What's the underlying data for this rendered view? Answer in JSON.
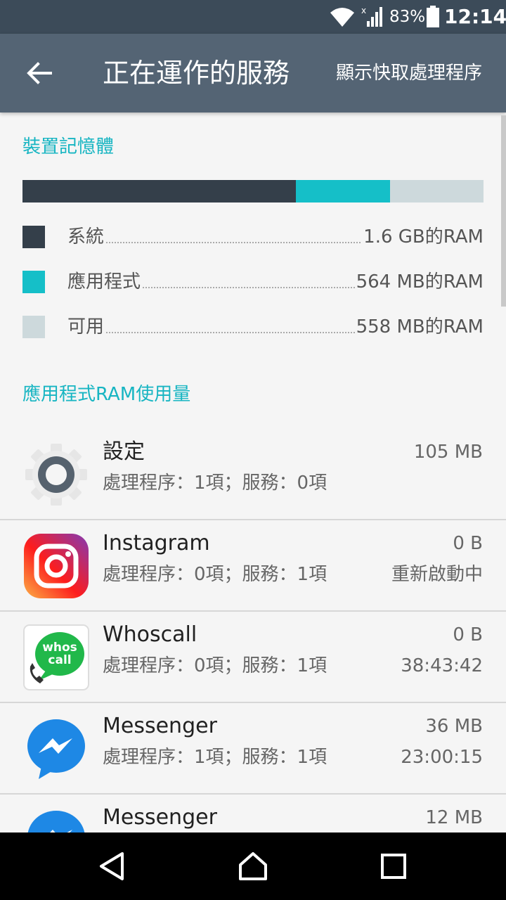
{
  "status_bar": {
    "battery_percent": "83%",
    "time": "12:14"
  },
  "toolbar": {
    "title": "正在運作的服務",
    "action_label": "顯示快取處理程序"
  },
  "memory": {
    "header": "裝置記憶體",
    "bar_fractions": {
      "system": 0.593,
      "apps": 0.204,
      "free": 0.203
    },
    "colors": {
      "system": "#343f4a",
      "apps": "#15bfc8",
      "free": "#cdd9dc"
    },
    "legend": [
      {
        "label": "系統",
        "value": "1.6 GB的RAM"
      },
      {
        "label": "應用程式",
        "value": "564 MB的RAM"
      },
      {
        "label": "可用",
        "value": "558 MB的RAM"
      }
    ]
  },
  "apps_header": "應用程式RAM使用量",
  "apps": [
    {
      "name": "設定",
      "desc": "處理程序：1項；服務：0項",
      "size": "105 MB",
      "status": "",
      "icon": "settings-gear-icon"
    },
    {
      "name": "Instagram",
      "desc": "處理程序：0項；服務：1項",
      "size": "0 B",
      "status": "重新啟動中",
      "icon": "instagram-icon"
    },
    {
      "name": "Whoscall",
      "desc": "處理程序：0項；服務：1項",
      "size": "0 B",
      "status": "38:43:42",
      "icon": "whoscall-icon",
      "icon_text": "whos call"
    },
    {
      "name": "Messenger",
      "desc": "處理程序：1項；服務：1項",
      "size": "36 MB",
      "status": "23:00:15",
      "icon": "messenger-icon"
    },
    {
      "name": "Messenger",
      "desc": "",
      "size": "12 MB",
      "status": "",
      "icon": "messenger-icon"
    }
  ]
}
